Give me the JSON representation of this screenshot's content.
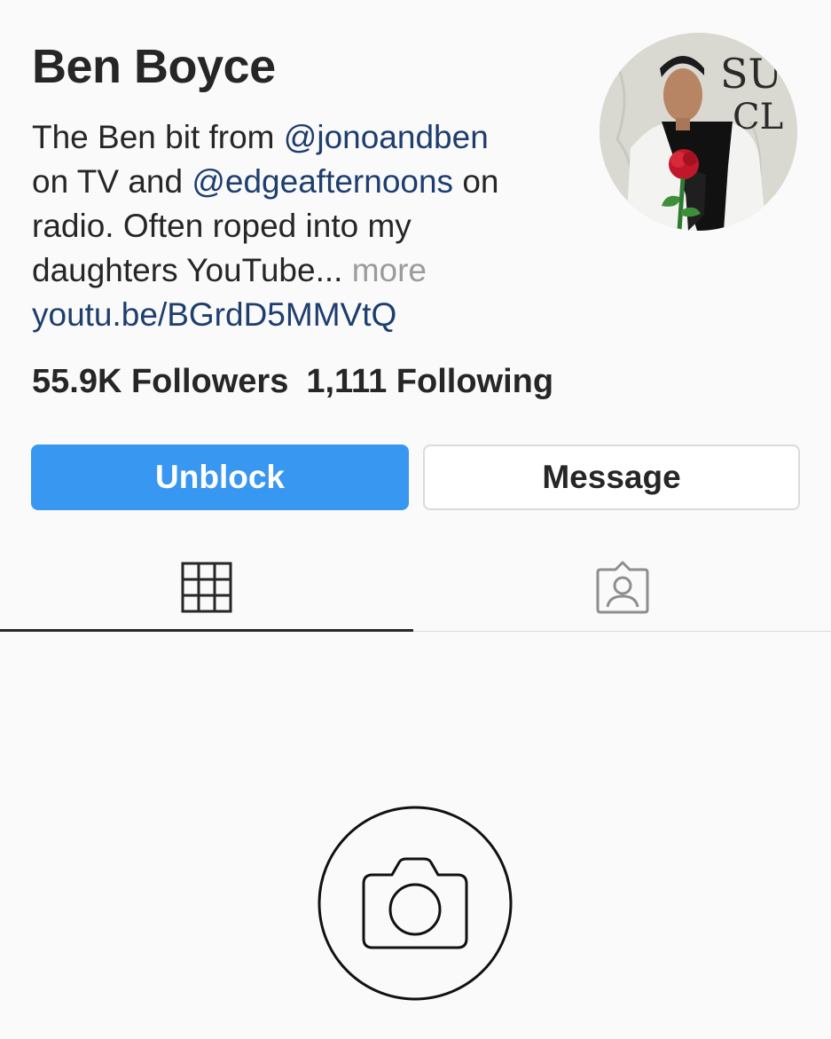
{
  "profile": {
    "name": "Ben Boyce",
    "bio": {
      "line1_text": "The Ben bit from ",
      "line1_mention": "@jonoandben",
      "line2_text_a": "on TV and ",
      "line2_mention": "@edgeafternoons",
      "line2_text_b": " on",
      "line3_text": "radio. Often roped into my",
      "line4_text": "daughters YouTube... ",
      "line4_more": "more",
      "link": "youtu.be/BGrdD5MMVtQ"
    },
    "followers": "55.9K Followers",
    "following": "1,111 Following",
    "avatar_icon": "profile-photo"
  },
  "actions": {
    "unblock_label": "Unblock",
    "message_label": "Message"
  },
  "tabs": [
    {
      "name": "grid",
      "icon": "grid-icon",
      "active": true
    },
    {
      "name": "tagged",
      "icon": "tagged-person-icon",
      "active": false
    }
  ],
  "empty_state": {
    "icon": "camera-icon"
  },
  "colors": {
    "accent": "#3897f0",
    "link": "#1d3e6e",
    "muted": "#9b9b9b",
    "text": "#262626",
    "background": "#fafafa"
  }
}
